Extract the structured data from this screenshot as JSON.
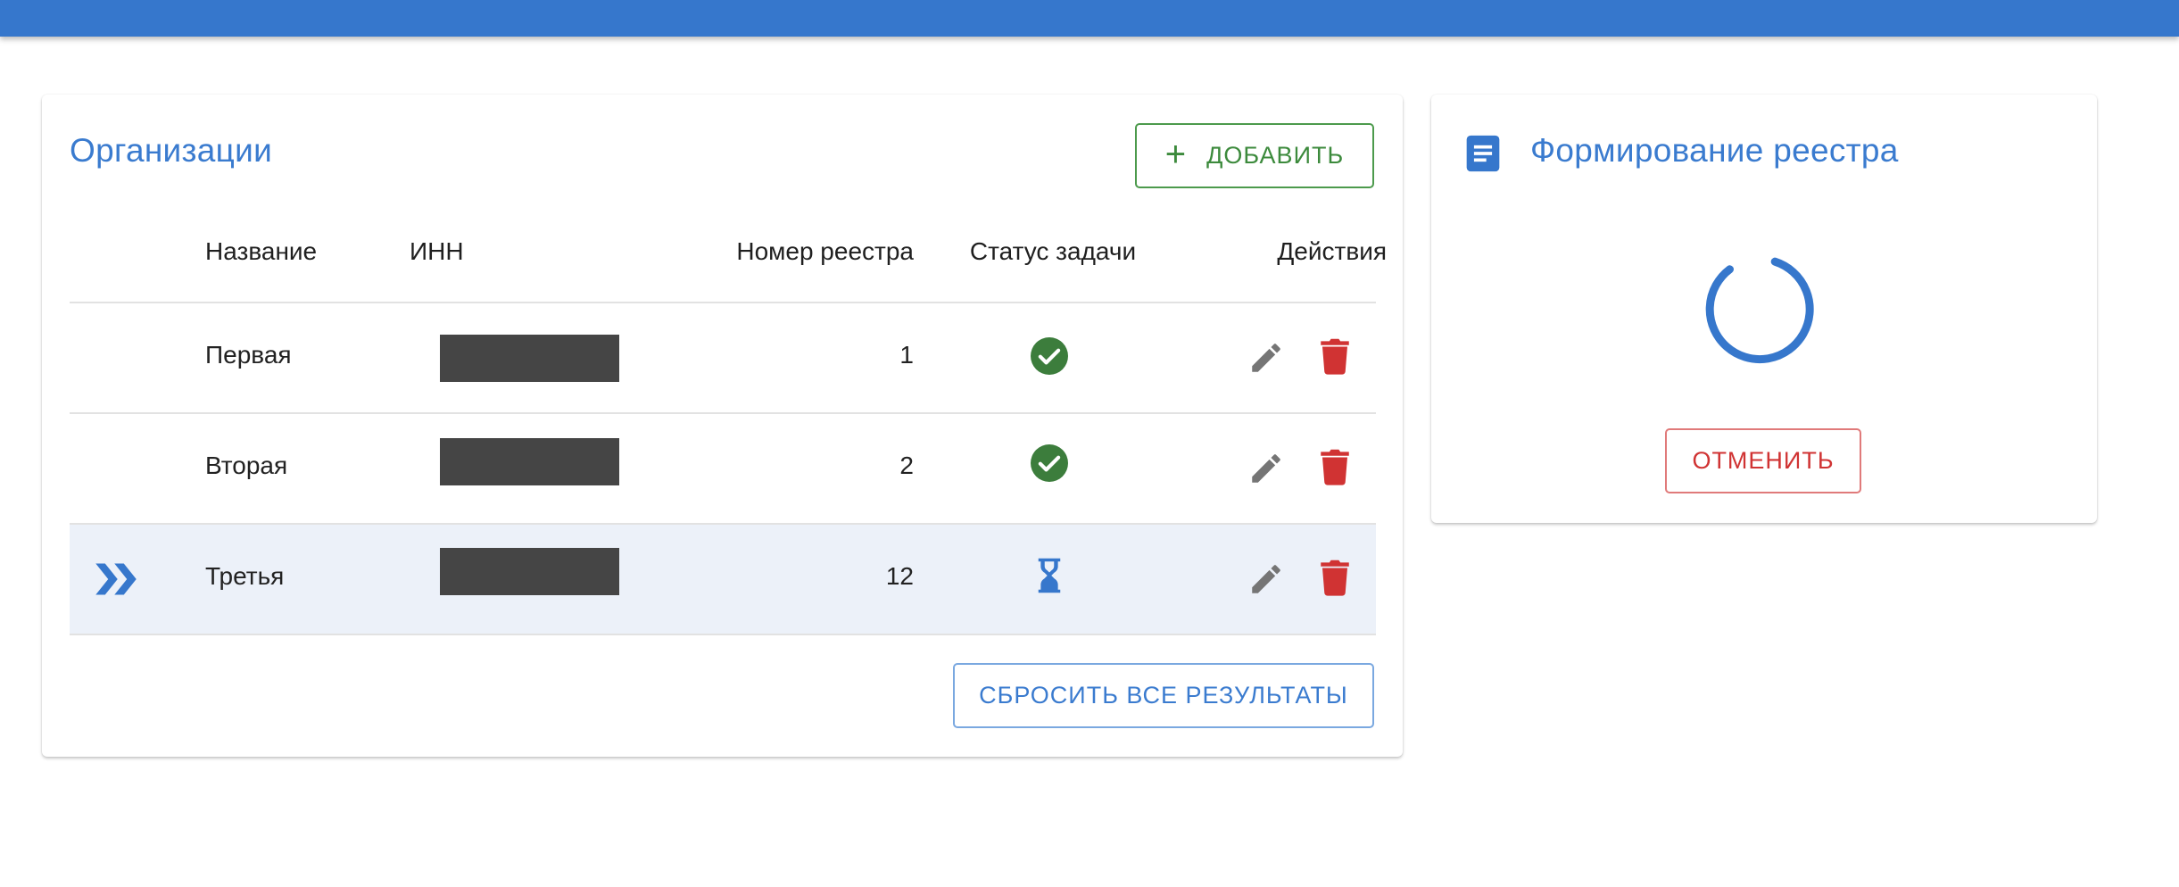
{
  "colors": {
    "primary": "#3677cc",
    "success": "#3c8a3c",
    "danger": "#d03333",
    "icon_gray": "#757575"
  },
  "organizations": {
    "title": "Организации",
    "add_button": "Добавить",
    "add_icon": "plus-icon",
    "columns": {
      "name": "Название",
      "inn": "ИНН",
      "registry_number": "Номер реестра",
      "task_status": "Статус задачи",
      "actions": "Действия"
    },
    "rows": [
      {
        "name": "Первая",
        "registry_number": "1",
        "status": "done",
        "status_icon": "check-circle-icon",
        "current": false
      },
      {
        "name": "Вторая",
        "registry_number": "2",
        "status": "done",
        "status_icon": "check-circle-icon",
        "current": false
      },
      {
        "name": "Третья",
        "registry_number": "12",
        "status": "in-progress",
        "status_icon": "hourglass-icon",
        "current": true,
        "current_icon": "double-chevron-right-icon"
      }
    ],
    "row_action_icons": [
      "pencil-icon",
      "trash-icon"
    ],
    "reset_button": "Сбросить все результаты"
  },
  "registry": {
    "title": "Формирование реестра",
    "title_icon": "document-icon",
    "progress": "indeterminate",
    "cancel_button": "Отменить"
  }
}
